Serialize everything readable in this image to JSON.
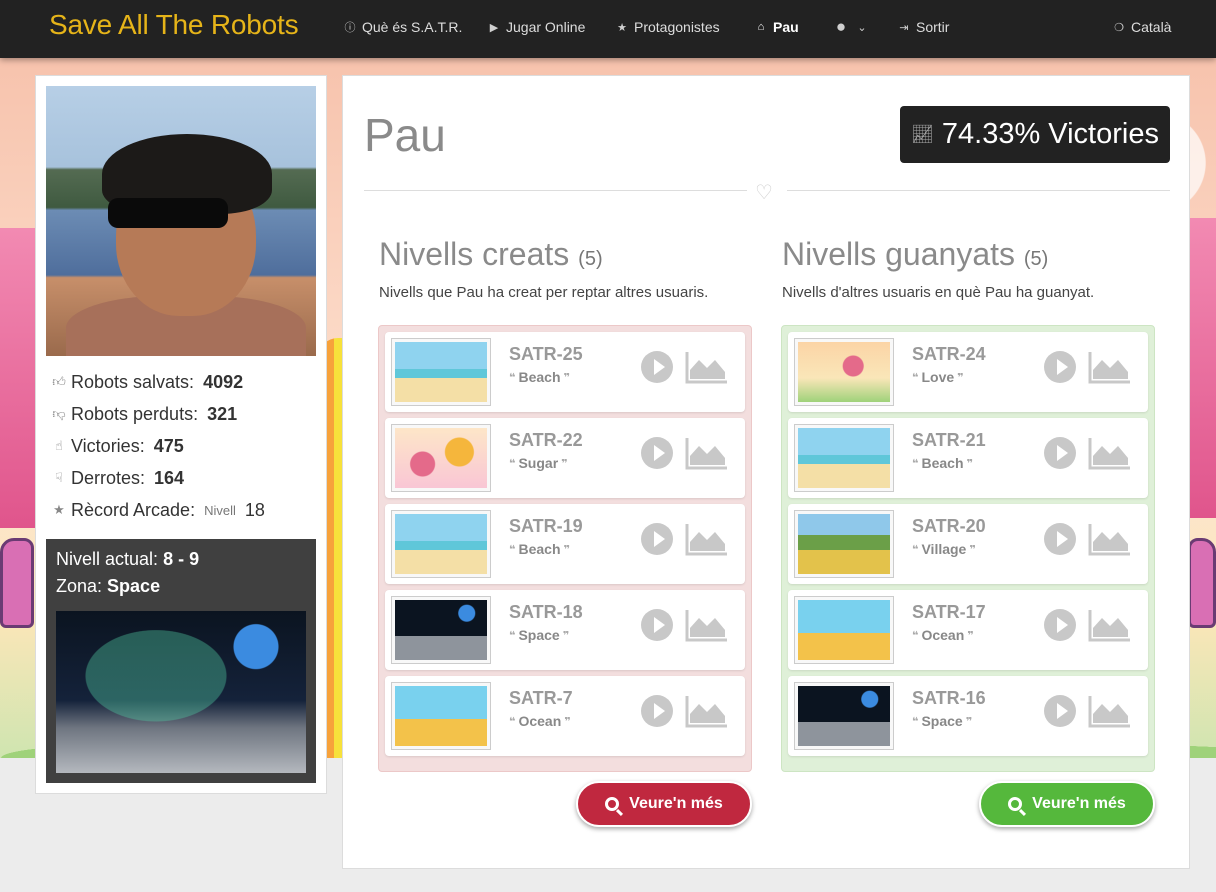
{
  "nav": {
    "brand": "Save All The Robots",
    "items": [
      {
        "icon": "info-icon",
        "label": "Què és S.A.T.R."
      },
      {
        "icon": "play-icon",
        "label": "Jugar Online"
      },
      {
        "icon": "star-icon",
        "label": "Protagonistes"
      },
      {
        "icon": "home-icon",
        "label": "Pau",
        "active": true
      },
      {
        "icon": "globe-icon",
        "label": ""
      },
      {
        "icon": "sign-out-icon",
        "label": "Sortir"
      },
      {
        "icon": "language-icon",
        "label": "Català"
      }
    ]
  },
  "profile": {
    "stats": [
      {
        "icon": "thumbs-up-icon",
        "label": "Robots salvats:",
        "value": "4092"
      },
      {
        "icon": "thumbs-down-icon",
        "label": "Robots perduts:",
        "value": "321"
      },
      {
        "icon": "thumbs-up-outline-icon",
        "label": "Victories:",
        "value": "475"
      },
      {
        "icon": "thumbs-down-outline-icon",
        "label": "Derrotes:",
        "value": "164"
      },
      {
        "icon": "star-icon",
        "label": "Rècord Arcade:",
        "small": "Nivell",
        "value": "18"
      }
    ],
    "zone": {
      "level_label": "Nivell actual:",
      "level_value": "8 - 9",
      "zone_label": "Zona:",
      "zone_value": "Space"
    }
  },
  "main": {
    "user_name": "Pau",
    "victories": "74.33% Victories",
    "created": {
      "title": "Nivells creats",
      "count": "(5)",
      "description": "Nivells que Pau ha creat per reptar altres usuaris.",
      "button": "Veure'n més",
      "levels": [
        {
          "name": "SATR-25",
          "zone": "Beach"
        },
        {
          "name": "SATR-22",
          "zone": "Sugar"
        },
        {
          "name": "SATR-19",
          "zone": "Beach"
        },
        {
          "name": "SATR-18",
          "zone": "Space"
        },
        {
          "name": "SATR-7",
          "zone": "Ocean"
        }
      ]
    },
    "won": {
      "title": "Nivells guanyats",
      "count": "(5)",
      "description": "Nivells d'altres usuaris en què Pau ha guanyat.",
      "button": "Veure'n més",
      "levels": [
        {
          "name": "SATR-24",
          "zone": "Love"
        },
        {
          "name": "SATR-21",
          "zone": "Beach"
        },
        {
          "name": "SATR-20",
          "zone": "Village"
        },
        {
          "name": "SATR-17",
          "zone": "Ocean"
        },
        {
          "name": "SATR-16",
          "zone": "Space"
        }
      ]
    }
  },
  "colors": {
    "navbar": "#222222",
    "brand": "#e6b419",
    "button_red": "#c0283f",
    "button_green": "#55b83c",
    "list_red": "#f3dede",
    "list_green": "#dff0d8"
  }
}
